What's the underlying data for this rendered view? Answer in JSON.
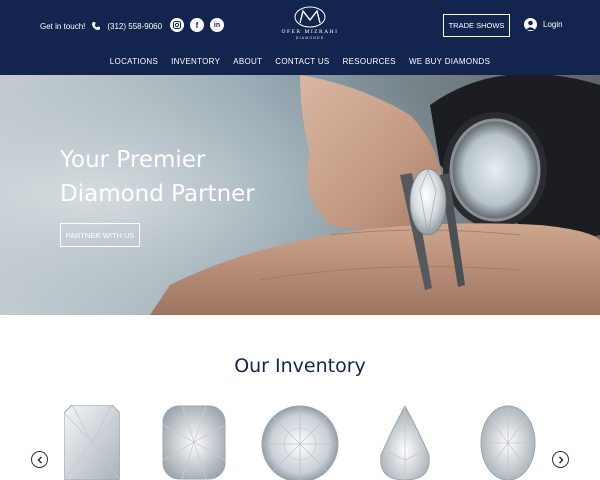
{
  "header": {
    "contact_label": "Get in touch!",
    "phone": "(312) 558-9060",
    "socials": [
      {
        "name": "instagram",
        "glyph": "◎"
      },
      {
        "name": "facebook",
        "glyph": "f"
      },
      {
        "name": "linkedin",
        "glyph": "in"
      }
    ],
    "logo": {
      "name": "OFER MIZRAHI",
      "sub": "DIAMONDS"
    },
    "trade_shows": "TRADE SHOWS",
    "login": "Login",
    "nav": [
      "LOCATIONS",
      "INVENTORY",
      "ABOUT",
      "CONTACT US",
      "RESOURCES",
      "WE BUY DIAMONDS"
    ]
  },
  "hero": {
    "title_line1": "Your Premier",
    "title_line2": "Diamond Partner",
    "button": "PARTNER WITH US"
  },
  "inventory": {
    "title": "Our Inventory",
    "diamond_shapes": [
      "radiant",
      "cushion",
      "round",
      "pear",
      "oval"
    ]
  },
  "colors": {
    "navy": "#13254f",
    "white": "#ffffff"
  }
}
